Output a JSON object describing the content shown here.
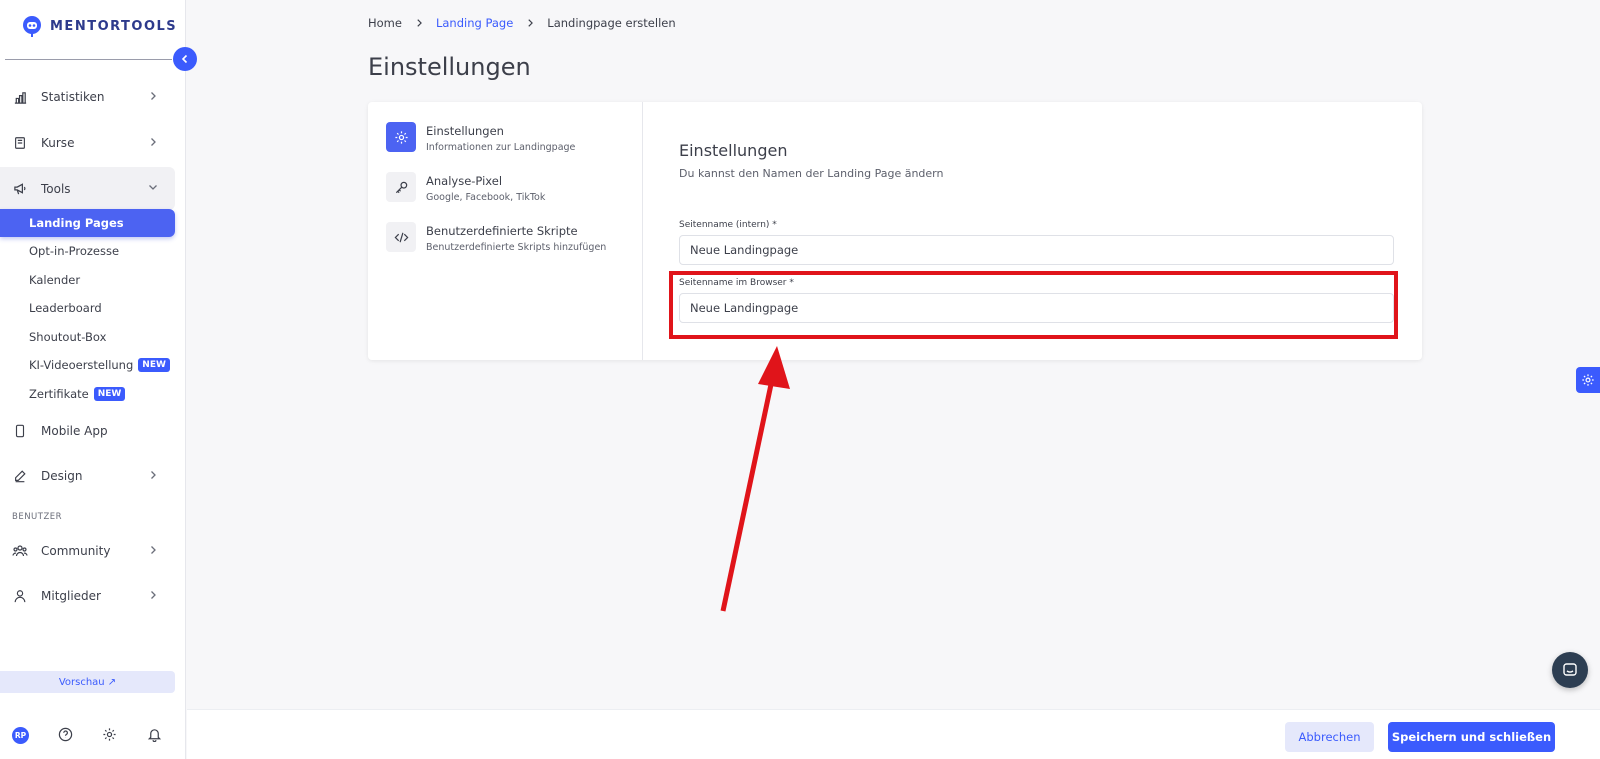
{
  "app": {
    "brand": "MENTORTOOLS"
  },
  "colors": {
    "accent": "#3b5bfd",
    "highlight": "#e0141a"
  },
  "sidebar": {
    "items": [
      {
        "label": "Statistiken",
        "icon": "bar-chart-icon"
      },
      {
        "label": "Kurse",
        "icon": "book-icon"
      },
      {
        "label": "Tools",
        "icon": "megaphone-icon"
      },
      {
        "label": "Mobile App",
        "icon": "smartphone-icon"
      },
      {
        "label": "Design",
        "icon": "pencil-icon"
      }
    ],
    "tools_subitems": [
      {
        "label": "Landing Pages"
      },
      {
        "label": "Opt-in-Prozesse"
      },
      {
        "label": "Kalender"
      },
      {
        "label": "Leaderboard"
      },
      {
        "label": "Shoutout-Box"
      },
      {
        "label": "KI-Videoerstellung",
        "badge": "NEW"
      },
      {
        "label": "Zertifikate",
        "badge": "NEW"
      }
    ],
    "section_label": "BENUTZER",
    "user_items": [
      {
        "label": "Community",
        "icon": "users-icon"
      },
      {
        "label": "Mitglieder",
        "icon": "user-icon"
      }
    ],
    "preview_label": "Vorschau ↗",
    "avatar_initials": "RP"
  },
  "breadcrumb": [
    "Home",
    "Landing Page",
    "Landingpage erstellen"
  ],
  "page_title": "Einstellungen",
  "steps": [
    {
      "title": "Einstellungen",
      "subtitle": "Informationen zur Landingpage",
      "icon": "gear-icon"
    },
    {
      "title": "Analyse-Pixel",
      "subtitle": "Google, Facebook, TikTok",
      "icon": "key-icon"
    },
    {
      "title": "Benutzerdefinierte Skripte",
      "subtitle": "Benutzerdefinierte Skripts hinzufügen",
      "icon": "code-icon"
    }
  ],
  "form": {
    "title": "Einstellungen",
    "subtitle": "Du kannst den Namen der Landing Page ändern",
    "fields": [
      {
        "label": "Seitenname (intern) *",
        "value": "Neue Landingpage"
      },
      {
        "label": "Seitenname im Browser *",
        "value": "Neue Landingpage"
      }
    ]
  },
  "footer": {
    "cancel": "Abbrechen",
    "save": "Speichern und schließen"
  }
}
